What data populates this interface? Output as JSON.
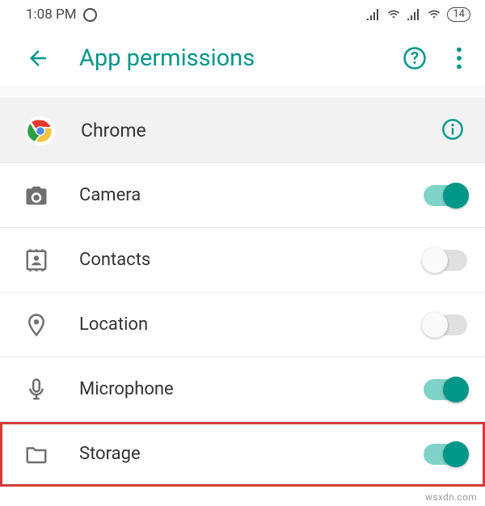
{
  "accent": "#009688",
  "statusbar": {
    "time": "1:08 PM",
    "battery": "14"
  },
  "header": {
    "title": "App permissions",
    "back_name": "back-icon",
    "help_name": "help-icon",
    "overflow_name": "overflow-menu-icon"
  },
  "app": {
    "name": "Chrome",
    "info_icon": "info-icon",
    "chrome_icon": "chrome-icon"
  },
  "permissions": [
    {
      "id": "camera",
      "label": "Camera",
      "icon": "camera-icon",
      "enabled": true,
      "highlight": false
    },
    {
      "id": "contacts",
      "label": "Contacts",
      "icon": "contacts-icon",
      "enabled": false,
      "highlight": false
    },
    {
      "id": "location",
      "label": "Location",
      "icon": "location-icon",
      "enabled": false,
      "highlight": false
    },
    {
      "id": "microphone",
      "label": "Microphone",
      "icon": "microphone-icon",
      "enabled": true,
      "highlight": false
    },
    {
      "id": "storage",
      "label": "Storage",
      "icon": "storage-icon",
      "enabled": true,
      "highlight": true
    }
  ],
  "watermark": "wsxdn.com"
}
